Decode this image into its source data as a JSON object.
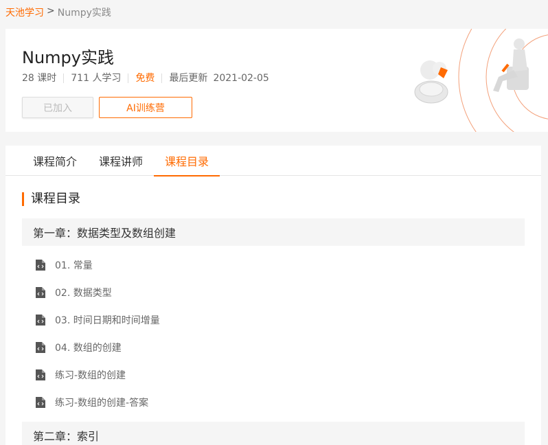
{
  "breadcrumb": {
    "home": "天池学习",
    "separator": ">",
    "current": "Numpy实践"
  },
  "course": {
    "title": "Numpy实践",
    "lessons_count": "28 课时",
    "learners": "711 人学习",
    "price": "免费",
    "updated_label": "最后更新",
    "updated_date": "2021-02-05",
    "joined_button": "已加入",
    "camp_button": "AI训练营"
  },
  "tabs": [
    {
      "label": "课程简介",
      "active": false
    },
    {
      "label": "课程讲师",
      "active": false
    },
    {
      "label": "课程目录",
      "active": true
    }
  ],
  "catalog": {
    "title": "课程目录",
    "chapters": [
      {
        "title": "第一章：数据类型及数组创建",
        "lessons": [
          {
            "label": "01. 常量",
            "icon": "code-file-icon"
          },
          {
            "label": "02. 数据类型",
            "icon": "code-file-icon"
          },
          {
            "label": "03. 时间日期和时间增量",
            "icon": "code-file-icon"
          },
          {
            "label": "04. 数组的创建",
            "icon": "code-file-icon"
          },
          {
            "label": "练习-数组的创建",
            "icon": "code-file-icon"
          },
          {
            "label": "练习-数组的创建-答案",
            "icon": "code-file-icon"
          }
        ]
      },
      {
        "title": "第二章：索引",
        "lessons": []
      }
    ]
  },
  "colors": {
    "accent": "#ff6a00",
    "text": "#333333",
    "muted": "#666666",
    "chapter_bg": "#f5f5f5"
  }
}
